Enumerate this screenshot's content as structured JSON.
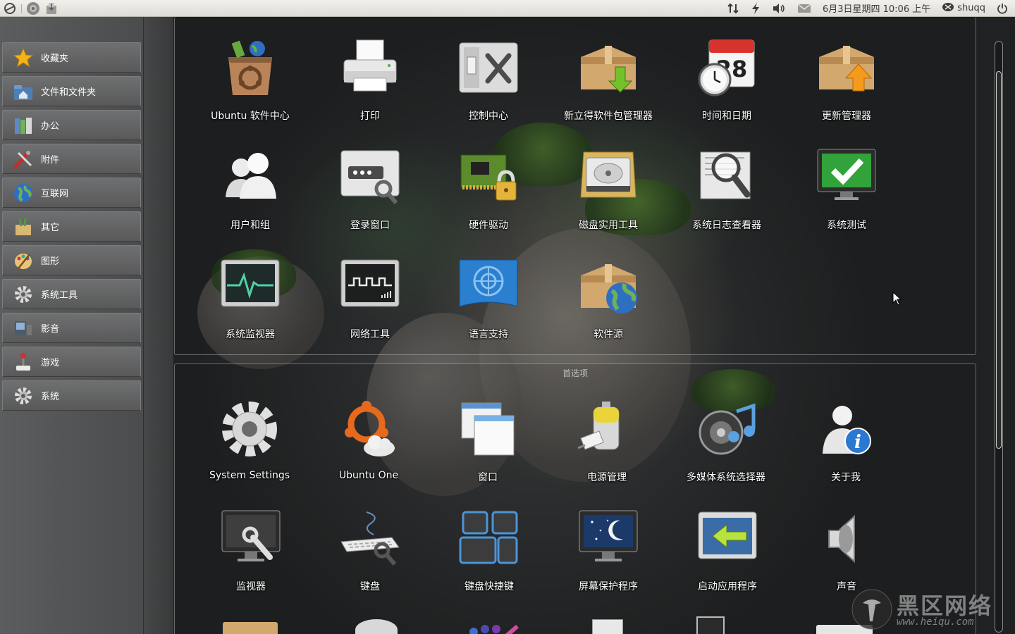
{
  "top_panel": {
    "left_icons": [
      "ubuntu-logo-icon",
      "browser-icon",
      "files-icon"
    ],
    "tray_icons": [
      "network-icon",
      "power-icon",
      "volume-icon",
      "mail-icon"
    ],
    "clock": "6月3日星期四 10:06 上午",
    "user": "shuqq",
    "shutdown_icon": "shutdown-icon"
  },
  "sidebar": {
    "categories": [
      {
        "label": "收藏夹",
        "icon": "star-icon"
      },
      {
        "label": "文件和文件夹",
        "icon": "home-folder-icon"
      },
      {
        "label": "办公",
        "icon": "office-icon"
      },
      {
        "label": "附件",
        "icon": "accessories-icon"
      },
      {
        "label": "互联网",
        "icon": "globe-icon"
      },
      {
        "label": "其它",
        "icon": "other-icon"
      },
      {
        "label": "图形",
        "icon": "graphics-icon"
      },
      {
        "label": "系统工具",
        "icon": "gear-icon"
      },
      {
        "label": "影音",
        "icon": "multimedia-icon"
      },
      {
        "label": "游戏",
        "icon": "joystick-icon"
      },
      {
        "label": "系统",
        "icon": "gear-icon"
      }
    ]
  },
  "admin_apps": [
    {
      "label": "Ubuntu 软件中心",
      "icon": "software-center-icon"
    },
    {
      "label": "打印",
      "icon": "printer-icon"
    },
    {
      "label": "控制中心",
      "icon": "control-center-icon"
    },
    {
      "label": "新立得软件包管理器",
      "icon": "synaptic-icon"
    },
    {
      "label": "时间和日期",
      "icon": "calendar-clock-icon"
    },
    {
      "label": "更新管理器",
      "icon": "update-manager-icon"
    },
    {
      "label": "用户和组",
      "icon": "users-icon"
    },
    {
      "label": "登录窗口",
      "icon": "login-window-icon"
    },
    {
      "label": "硬件驱动",
      "icon": "hardware-driver-icon"
    },
    {
      "label": "磁盘实用工具",
      "icon": "disk-utility-icon"
    },
    {
      "label": "系统日志查看器",
      "icon": "log-viewer-icon"
    },
    {
      "label": "系统测试",
      "icon": "system-test-icon"
    },
    {
      "label": "系统监视器",
      "icon": "system-monitor-icon"
    },
    {
      "label": "网络工具",
      "icon": "network-tools-icon"
    },
    {
      "label": "语言支持",
      "icon": "language-support-icon"
    },
    {
      "label": "软件源",
      "icon": "software-sources-icon"
    }
  ],
  "preferences_section": {
    "title": "首选项",
    "apps": [
      {
        "label": "System Settings",
        "icon": "system-settings-icon"
      },
      {
        "label": "Ubuntu One",
        "icon": "ubuntu-one-icon"
      },
      {
        "label": "窗口",
        "icon": "windows-icon"
      },
      {
        "label": "电源管理",
        "icon": "power-management-icon"
      },
      {
        "label": "多媒体系统选择器",
        "icon": "multimedia-selector-icon"
      },
      {
        "label": "关于我",
        "icon": "about-me-icon"
      },
      {
        "label": "监视器",
        "icon": "monitor-icon"
      },
      {
        "label": "键盘",
        "icon": "keyboard-icon"
      },
      {
        "label": "键盘快捷键",
        "icon": "keyboard-shortcuts-icon"
      },
      {
        "label": "屏幕保护程序",
        "icon": "screensaver-icon"
      },
      {
        "label": "启动应用程序",
        "icon": "startup-apps-icon"
      },
      {
        "label": "声音",
        "icon": "sound-icon"
      }
    ]
  },
  "watermark": {
    "text": "黑区网络",
    "url": "www.heiqu.com"
  }
}
